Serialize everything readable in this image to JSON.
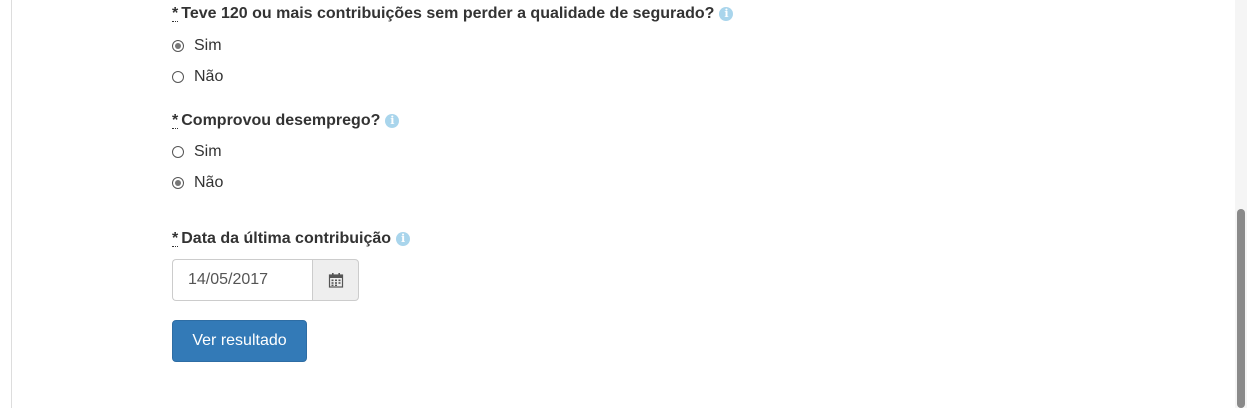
{
  "form": {
    "required_mark": "*",
    "q1": {
      "label": "Teve 120 ou mais contribuições sem perder a qualidade de segurado?",
      "options": [
        "Sim",
        "Não"
      ],
      "selected": "Sim"
    },
    "q2": {
      "label": "Comprovou desemprego?",
      "options": [
        "Sim",
        "Não"
      ],
      "selected": "Não"
    },
    "date": {
      "label": "Data da última contribuição",
      "value": "14/05/2017"
    },
    "submit_label": "Ver resultado"
  },
  "icons": {
    "info": "info-icon",
    "calendar": "calendar-icon"
  },
  "colors": {
    "primary_button": "#337ab7",
    "info_icon": "#a9d5ec",
    "text": "#333333"
  }
}
